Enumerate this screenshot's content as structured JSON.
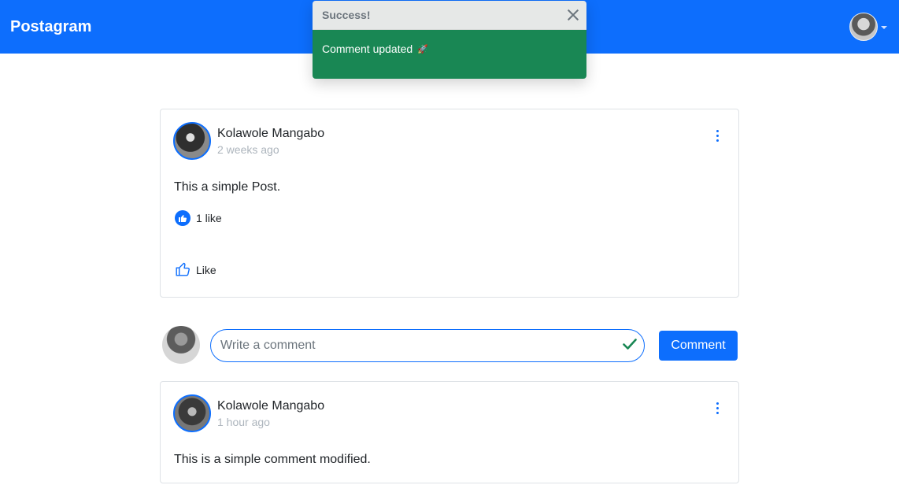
{
  "navbar": {
    "brand": "Postagram"
  },
  "toast": {
    "title": "Success!",
    "message": "Comment updated",
    "emoji": "🚀"
  },
  "post": {
    "author": "Kolawole Mangabo",
    "time": "2 weeks ago",
    "body": "This a simple Post.",
    "likes_text": "1 like",
    "like_action": "Like"
  },
  "comment_form": {
    "placeholder": "Write a comment",
    "submit_label": "Comment"
  },
  "comment": {
    "author": "Kolawole Mangabo",
    "time": "1 hour ago",
    "body": "This is a simple comment modified."
  },
  "colors": {
    "primary": "#0d6efd",
    "success": "#198754",
    "valid": "#198754"
  },
  "icons": [
    "avatar",
    "caret-down-icon",
    "close-icon",
    "rocket-icon",
    "more-vertical-icon",
    "thumbs-up-icon",
    "check-icon"
  ]
}
